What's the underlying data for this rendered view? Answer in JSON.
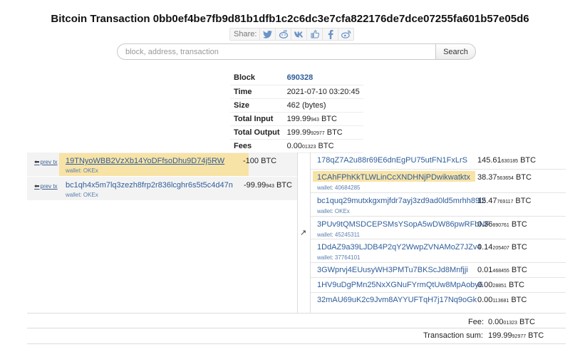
{
  "title": "Bitcoin Transaction 0bb0ef4be7fb9d81b1dfb1c2c6dc3e7cfa822176de7dce07255fa601b57e05d6",
  "share": {
    "label": "Share:",
    "icons": [
      "twitter-icon",
      "reddit-icon",
      "vk-icon",
      "like-icon",
      "facebook-icon",
      "weibo-icon"
    ]
  },
  "search": {
    "placeholder": "block, address, transaction",
    "button": "Search"
  },
  "info": [
    {
      "key": "Block",
      "value": "690328"
    },
    {
      "key": "Time",
      "value": "2021-07-10 03:20:45"
    },
    {
      "key": "Size",
      "value": "462 (bytes)"
    },
    {
      "key": "Total Input",
      "value": "199.99",
      "small": "943",
      "unit": " BTC"
    },
    {
      "key": "Total Output",
      "value": "199.99",
      "small": "92977",
      "unit": " BTC"
    },
    {
      "key": "Fees",
      "value": "0.00",
      "small": "01323",
      "unit": " BTC"
    }
  ],
  "inputs": [
    {
      "prev": "prev tx",
      "address": "19TNyoWBB2VzXb14YoDFfsoDhu9D74j5RW",
      "wallet": "wallet: OKEx",
      "amount": "-100 BTC",
      "small": "",
      "unit": ""
    },
    {
      "prev": "prev tx",
      "address": "bc1qh4x5m7lq3zezh8frp2r836lcghr6s5t5c4d47n",
      "wallet": "wallet: OKEx",
      "amount": "-99.99",
      "small": "943",
      "unit": " BTC"
    }
  ],
  "outputs": [
    {
      "address": "178qZ7A2u88r69E6dnEgPU75utFN1FxLrS",
      "wallet": "",
      "amount": "145.61",
      "small": "630185",
      "unit": " BTC"
    },
    {
      "address": "1CAhFPhKkTLWLinCcXNDHNjPDwikwatktx",
      "wallet": "wallet: 40684285",
      "amount": "38.37",
      "small": "563654",
      "unit": " BTC"
    },
    {
      "address": "bc1quq29mutxkgxmjfdr7ayj3zd9ad0ld5mrhh89l2",
      "wallet": "wallet: OKEx",
      "amount": "15.47",
      "small": "769117",
      "unit": " BTC"
    },
    {
      "address": "3PUv9tQMSDCEPSMsYSopA5wDW86pwRFbNF",
      "wallet": "wallet: 45245311",
      "amount": "0.36",
      "small": "890761",
      "unit": " BTC"
    },
    {
      "address": "1DdAZ9a39LJDB4P2qY2WwpZVNAMoZ7JZv4",
      "wallet": "wallet: 37764101",
      "amount": "0.14",
      "small": "205407",
      "unit": " BTC"
    },
    {
      "address": "3GWprvj4EUusyWH3PMTu7BKScJd8Mnfjji",
      "wallet": "",
      "amount": "0.01",
      "small": "468455",
      "unit": " BTC"
    },
    {
      "address": "1HV9uDgPMn25NxXGNuFYrmQtUw8MpAoby6",
      "wallet": "",
      "amount": "0.00",
      "small": "28851",
      "unit": " BTC"
    },
    {
      "address": "32mAU69uK2c9Jvm8AYYUFTqH7j17Nq9oGk",
      "wallet": "",
      "amount": "0.00",
      "small": "113681",
      "unit": " BTC"
    }
  ],
  "footer": {
    "fee_label": "Fee:",
    "fee_value": "0.00",
    "fee_small": "01323",
    "fee_unit": " BTC",
    "sum_label": "Transaction sum:",
    "sum_value": "199.99",
    "sum_small": "92977",
    "sum_unit": " BTC"
  },
  "colors": {
    "link": "#2f5d9a",
    "highlight": "#f8e3a6",
    "row_bg": "#f3f3f3"
  }
}
